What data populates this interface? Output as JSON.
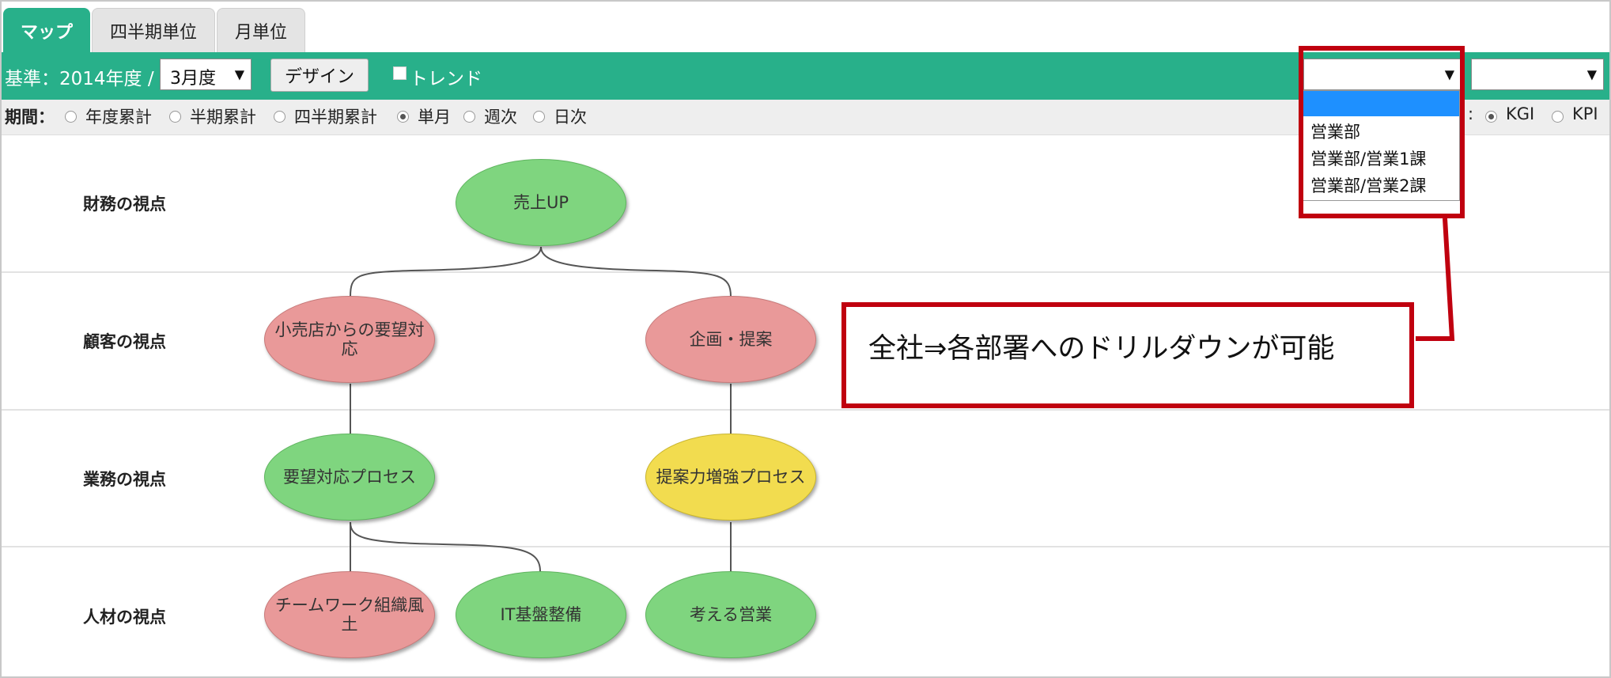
{
  "tabs": [
    {
      "label": "マップ",
      "active": true
    },
    {
      "label": "四半期単位",
      "active": false
    },
    {
      "label": "月単位",
      "active": false
    }
  ],
  "toolbar": {
    "base_label": "基準：2014年度 /",
    "month_select": "3月度",
    "design_button": "デザイン",
    "trend_label": "トレンド",
    "dept_select": "",
    "sub_select": ""
  },
  "period": {
    "label": "期間：",
    "options": [
      "年度累計",
      "半期累計",
      "四半期累計",
      "単月",
      "週次",
      "日次"
    ],
    "selected": "単月",
    "indicator_colon": ":",
    "indicator_options": [
      "KGI",
      "KPI"
    ],
    "indicator_selected": "KGI"
  },
  "dept_dropdown": {
    "options": [
      "",
      "営業部",
      "営業部/営業1課",
      "営業部/営業2課"
    ]
  },
  "perspectives": [
    "財務の視点",
    "顧客の視点",
    "業務の視点",
    "人材の視点"
  ],
  "nodes": {
    "uriage": "売上UP",
    "kouri": "小売店からの要望対応",
    "kikaku": "企画・提案",
    "youbou": "要望対応プロセス",
    "teian": "提案力増強プロセス",
    "team": "チームワーク組織風土",
    "it": "IT基盤整備",
    "kangaeru": "考える営業"
  },
  "callout": "全社⇒各部署へのドリルダウンが可能",
  "colors": {
    "accent": "#28b08a",
    "node_green": "#7fd57f",
    "node_red": "#e99999",
    "node_yellow": "#f2dc4f",
    "highlight": "#c0000f"
  }
}
